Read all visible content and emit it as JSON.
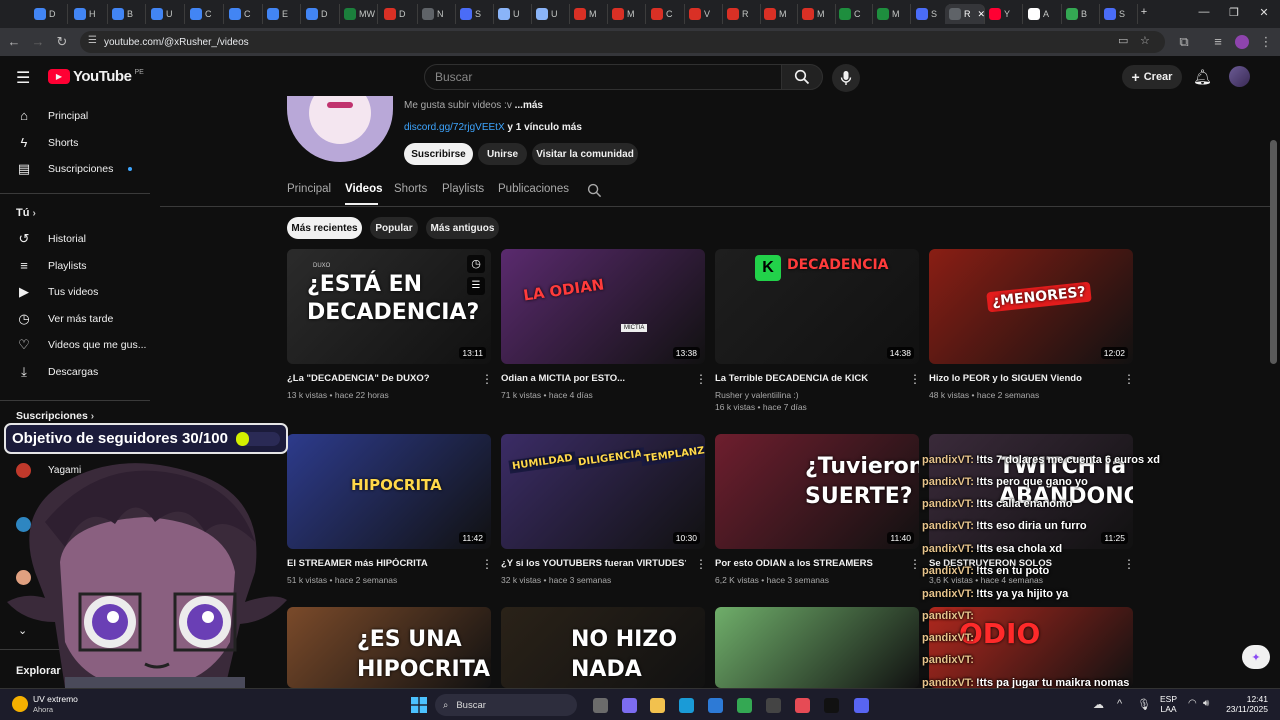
{
  "browser": {
    "tabs": [
      {
        "label": "D",
        "color": "#4285f4"
      },
      {
        "label": "H",
        "color": "#4285f4"
      },
      {
        "label": "B",
        "color": "#4285f4"
      },
      {
        "label": "U",
        "color": "#4285f4"
      },
      {
        "label": "C",
        "color": "#4285f4"
      },
      {
        "label": "C",
        "color": "#4285f4"
      },
      {
        "label": "E",
        "color": "#4285f4"
      },
      {
        "label": "D",
        "color": "#4285f4"
      },
      {
        "label": "MW E",
        "color": "#1b7f3c"
      },
      {
        "label": "D",
        "color": "#d93025"
      },
      {
        "label": "N",
        "color": "#5f6368"
      },
      {
        "label": "S",
        "color": "#4a6cf7"
      },
      {
        "label": "U",
        "color": "#8ab4f8"
      },
      {
        "label": "U",
        "color": "#8ab4f8"
      },
      {
        "label": "M",
        "color": "#d93025"
      },
      {
        "label": "M",
        "color": "#d93025"
      },
      {
        "label": "C",
        "color": "#d93025"
      },
      {
        "label": "V",
        "color": "#d93025"
      },
      {
        "label": "R",
        "color": "#d93025"
      },
      {
        "label": "M",
        "color": "#d93025"
      },
      {
        "label": "M",
        "color": "#d93025"
      },
      {
        "label": "C",
        "color": "#1e8e3e"
      },
      {
        "label": "M",
        "color": "#1e8e3e"
      },
      {
        "label": "S",
        "color": "#4a6cf7"
      },
      {
        "label": "R",
        "color": "#5f6368",
        "active": true
      },
      {
        "label": "Y",
        "color": "#ff0033"
      },
      {
        "label": "A",
        "color": "#ffffff"
      },
      {
        "label": "B",
        "color": "#34a853"
      },
      {
        "label": "S",
        "color": "#4a6cf7"
      }
    ],
    "new_tab": "+",
    "url": "youtube.com/@xRusher_/videos"
  },
  "youtube": {
    "logo_text": "YouTube",
    "region": "PE",
    "search_placeholder": "Buscar",
    "create_label": "Crear"
  },
  "sidebar": {
    "main": [
      {
        "label": "Principal",
        "icon": "home-icon"
      },
      {
        "label": "Shorts",
        "icon": "shorts-icon"
      },
      {
        "label": "Suscripciones",
        "icon": "subscriptions-icon"
      }
    ],
    "you_header": "Tú",
    "you": [
      {
        "label": "Historial",
        "icon": "history-icon"
      },
      {
        "label": "Playlists",
        "icon": "playlists-icon"
      },
      {
        "label": "Tus videos",
        "icon": "your-videos-icon"
      },
      {
        "label": "Ver más tarde",
        "icon": "watch-later-icon"
      },
      {
        "label": "Videos que me gus...",
        "icon": "liked-icon"
      },
      {
        "label": "Descargas",
        "icon": "downloads-icon"
      }
    ],
    "subs_header": "Suscripciones",
    "subs_visible": [
      {
        "label": "Yagami"
      }
    ],
    "explore_header": "Explorar"
  },
  "channel": {
    "description": "Me gusta subir videos :v",
    "more_link": "...más",
    "link_text": "discord.gg/72rjgVEEtX",
    "extra_links": "y 1 vínculo más",
    "buttons": {
      "subscribe": "Suscribirse",
      "join": "Unirse",
      "community": "Visitar la comunidad"
    },
    "tabs": [
      "Principal",
      "Videos",
      "Shorts",
      "Playlists",
      "Publicaciones"
    ],
    "active_tab": "Videos",
    "filters": [
      "Más recientes",
      "Popular",
      "Más antiguos"
    ],
    "active_filter": "Más recientes"
  },
  "videos": [
    {
      "title": "¿La \"DECADENCIA\" De DUXO?",
      "views": "13 k vistas",
      "age": "hace 22 horas",
      "duration": "13:11",
      "thumb_text": "¿ESTÁ EN DECADENCIA?",
      "thumb_color": "#2b2b2b",
      "channel": "DUXO"
    },
    {
      "title": "Odian a MICTIA por ESTO...",
      "views": "71 k vistas",
      "age": "hace 4 días",
      "duration": "13:38",
      "thumb_text": "LA ODIAN",
      "thumb_color": "#5a2a6e",
      "sign": "MICTIA"
    },
    {
      "title": "La Terrible DECADENCIA de KICK",
      "author": "Rusher y valentiilina :)",
      "views": "16 k vistas",
      "age": "hace 7 días",
      "duration": "14:38",
      "thumb_text": "DECADENCIA",
      "thumb_color": "#1e1e1e",
      "badge": "K"
    },
    {
      "title": "Hizo lo PEOR y lo SIGUEN Viendo",
      "views": "48 k vistas",
      "age": "hace 2 semanas",
      "duration": "12:02",
      "thumb_text": "¿MENORES?",
      "thumb_color": "#8a1e14"
    },
    {
      "title": "El STREAMER más HIPÓCRITA",
      "views": "51 k vistas",
      "age": "hace 2 semanas",
      "duration": "11:42",
      "thumb_text": "HIPOCRITA",
      "thumb_color": "#2d3b8c"
    },
    {
      "title": "¿Y si los YOUTUBERS fueran VIRTUDES?",
      "views": "32 k vistas",
      "age": "hace 3 semanas",
      "duration": "10:30",
      "thumb_text": "HUMILDAD · DILIGENCIA · TEMPLANZA",
      "thumb_color": "#3b2c66",
      "labels": [
        "HUMILDAD",
        "DILIGENCIA",
        "TEMPLANZA"
      ]
    },
    {
      "title": "Por esto ODIAN a los STREAMERS",
      "views": "6,2 K vistas",
      "age": "hace 3 semanas",
      "duration": "11:40",
      "thumb_text": "¿Tuvieron SUERTE?",
      "thumb_color": "#6e1e2e",
      "lines": [
        "¿Tuvieron",
        "SUERTE?"
      ]
    },
    {
      "title": "Se DESTRUYERON SOLOS",
      "views": "3,6 K vistas",
      "age": "hace 4 semanas",
      "duration": "11:25",
      "thumb_text": "TWITCH LA ...ABANDONO",
      "thumb_color": "#3a2a3a",
      "lines": [
        "TWITCH la",
        "ABANDONO"
      ]
    },
    {
      "title": "",
      "thumb_text": "¿ES UNA HIPOCRITA?",
      "thumb_color": "#7a4a2a",
      "lines": [
        "¿ES UNA",
        "HIPOCRITA?"
      ]
    },
    {
      "title": "",
      "thumb_text": "NO HIZO NADA",
      "thumb_color": "#2a2218",
      "lines": [
        "NO HIZO",
        "NADA"
      ]
    },
    {
      "title": "",
      "thumb_text": "",
      "thumb_color": "#6fae6a"
    },
    {
      "title": "",
      "thumb_text": "ODIO",
      "thumb_color": "#b0281e"
    }
  ],
  "overlay": {
    "goal_label": "Objetivo de seguidores 30/100",
    "goal_progress": 0.3,
    "chat": [
      {
        "user": "pandixVT:",
        "msg": "!tts 7 dolares me cuenta 6 euros xd"
      },
      {
        "user": "pandixVT:",
        "msg": "!tts pero que gano yo"
      },
      {
        "user": "pandixVT:",
        "msg": "!tts calla enanomo"
      },
      {
        "user": "pandixVT:",
        "msg": "!tts eso diria un furro"
      },
      {
        "user": "pandixVT:",
        "msg": "!tts esa chola xd"
      },
      {
        "user": "pandixVT:",
        "msg": "!tts en tu poto"
      },
      {
        "user": "pandixVT:",
        "msg": "!tts ya ya hijito ya"
      },
      {
        "user": "pandixVT:",
        "msg": ""
      },
      {
        "user": "pandixVT:",
        "msg": ""
      },
      {
        "user": "pandixVT:",
        "msg": ""
      },
      {
        "user": "pandixVT:",
        "msg": "!tts pa jugar tu maikra nomas"
      },
      {
        "user": "pandixVT:",
        "msg": "!tts xd mas pelejo"
      }
    ]
  },
  "taskbar": {
    "weather_temp": "UV extremo",
    "weather_sub": "Ahora",
    "search_label": "Buscar",
    "lang": "ESP",
    "lang_sub": "LAA",
    "time": "12:41",
    "date": "23/11/2025"
  }
}
